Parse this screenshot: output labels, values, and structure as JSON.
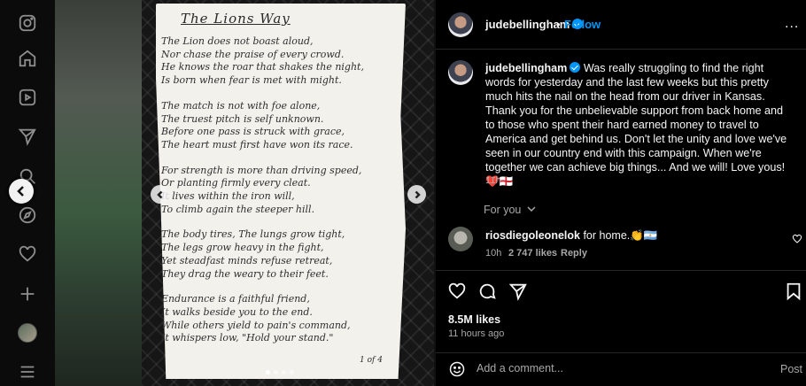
{
  "sidebar": {
    "icons": [
      "instagram-icon",
      "home-icon",
      "reels-icon",
      "send-icon",
      "search-icon",
      "explore-icon",
      "heart-icon",
      "create-icon",
      "profile-avatar",
      "menu-icon"
    ]
  },
  "post": {
    "image": {
      "title": "The Lions Way",
      "stanzas": [
        [
          "The Lion does not boast aloud,",
          "Nor chase the praise of every crowd.",
          "He knows the roar that shakes the night,",
          "Is born when fear is met with might."
        ],
        [
          "The match is not with foe alone,",
          "The truest pitch is self unknown.",
          "Before one pass is struck with grace,",
          "The heart must first have won its race."
        ],
        [
          "For strength is more than driving speed,",
          "Or planting firmly every cleat.",
          "It lives within the iron will,",
          "To climb again the steeper hill."
        ],
        [
          "The body tires, The lungs grow tight,",
          "The legs grow heavy in the fight,",
          "Yet steadfast minds refuse retreat,",
          "They drag the weary to their feet."
        ],
        [
          "Endurance is a faithful friend,",
          "It walks beside you to the end.",
          "While others yield to pain's command,",
          "It whispers low, \"Hold your stand.\""
        ]
      ],
      "page_label": "1 of 4",
      "slide_count": 4,
      "active_slide": 1
    },
    "header": {
      "username": "judebellingham",
      "separator": "•",
      "follow_label": "Follow",
      "more_label": "..."
    },
    "caption": {
      "username": "judebellingham",
      "text": " Was really struggling to find the right words for yesterday and the last few weeks but this pretty much hits the nail on the head from our driver in Kansas. Thank you for the unbelievable support from back home and to those who spent their hard earned money to travel to America and get behind us. Don't let the unity and love we've seen in our country end with this campaign. When we're together we can achieve big things... And we will! Love yous! ❤️🏴󠁧󠁢󠁥󠁮󠁧󠁿",
      "time": "11h"
    },
    "for_you_label": "For you",
    "comment": {
      "username": "riosdiegoleonelok",
      "text": " for home.👏🇦🇷",
      "time": "10h",
      "likes": "2 747 likes",
      "reply_label": "Reply"
    },
    "likes": "8.5M likes",
    "posted_ago": "11 hours ago",
    "add_comment_placeholder": "Add a comment...",
    "post_label": "Post"
  }
}
